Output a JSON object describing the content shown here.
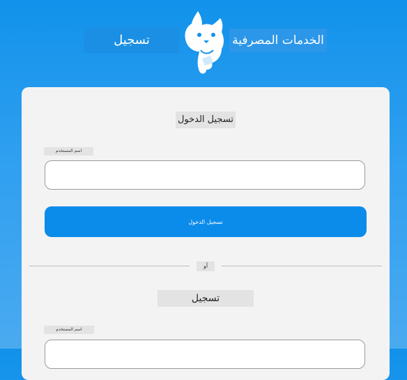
{
  "header": {
    "app_name": "تسجيل",
    "bank_name": "الخدمات المصرفية",
    "logo_icon": "cat-mascot-logo"
  },
  "login": {
    "title": "تسجيل الدخول",
    "field_label": "اسم المستخدم",
    "field_value": "",
    "submit_label": "تسجيل الدخول"
  },
  "divider": {
    "or_label": "أو"
  },
  "register": {
    "title": "تسجيل",
    "field_label": "اسم المستخدم",
    "field_value": ""
  },
  "colors": {
    "background": "#1192ea",
    "primary": "#0b8ceb",
    "card": "#f3f3f3"
  }
}
